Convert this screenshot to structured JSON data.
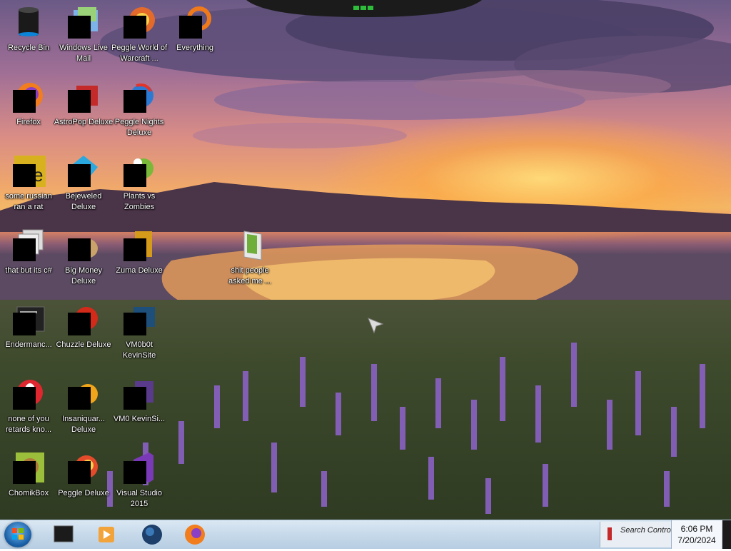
{
  "desktop_icons": [
    {
      "label": "Recycle Bin",
      "icon": "recycle-bin-icon"
    },
    {
      "label": "Windows Live Mail",
      "icon": "mail-icon"
    },
    {
      "label": "Peggle World of Warcraft ...",
      "icon": "peggle-wow-icon"
    },
    {
      "label": "Everything",
      "icon": "everything-search-icon"
    },
    {
      "label": "Firefox",
      "icon": "firefox-icon"
    },
    {
      "label": "AstroPop Deluxe",
      "icon": "astropop-icon"
    },
    {
      "label": "Peggle Nights Deluxe",
      "icon": "peggle-nights-icon"
    },
    {
      "label": "some russian ran a rat",
      "icon": "file-icon"
    },
    {
      "label": "Bejeweled Deluxe",
      "icon": "bejeweled-icon"
    },
    {
      "label": "Plants vs Zombies",
      "icon": "plants-vs-zombies-icon"
    },
    {
      "label": "that but its c#",
      "icon": "copy-files-icon"
    },
    {
      "label": "Big Money Deluxe",
      "icon": "big-money-icon"
    },
    {
      "label": "Zuma Deluxe",
      "icon": "zuma-icon"
    },
    {
      "label": "shit people asked me ...",
      "icon": "folder-icon"
    },
    {
      "label": "Endermanc...",
      "icon": "terminal-icon"
    },
    {
      "label": "Chuzzle Deluxe",
      "icon": "chuzzle-icon"
    },
    {
      "label": "VM0b0t KevinSite",
      "icon": "vm-icon"
    },
    {
      "label": "none of you retards kno...",
      "icon": "opera-icon"
    },
    {
      "label": "Insaniquar... Deluxe",
      "icon": "insaniquarium-icon"
    },
    {
      "label": "VM0 KevinSi...",
      "icon": "vm-icon"
    },
    {
      "label": "ChomikBox",
      "icon": "chomikbox-icon"
    },
    {
      "label": "Peggle Deluxe",
      "icon": "peggle-icon"
    },
    {
      "label": "Visual Studio 2015",
      "icon": "visual-studio-icon"
    }
  ],
  "taskbar": {
    "pinned": [
      "cmd-icon",
      "media-player-icon",
      "globe-icon",
      "firefox-icon"
    ],
    "tray_app_text": "Search Control",
    "time": "6:06 PM",
    "date": "7/20/2024"
  },
  "colors": {
    "taskbar": "#c6d9ea",
    "label_text": "#ffffff"
  }
}
